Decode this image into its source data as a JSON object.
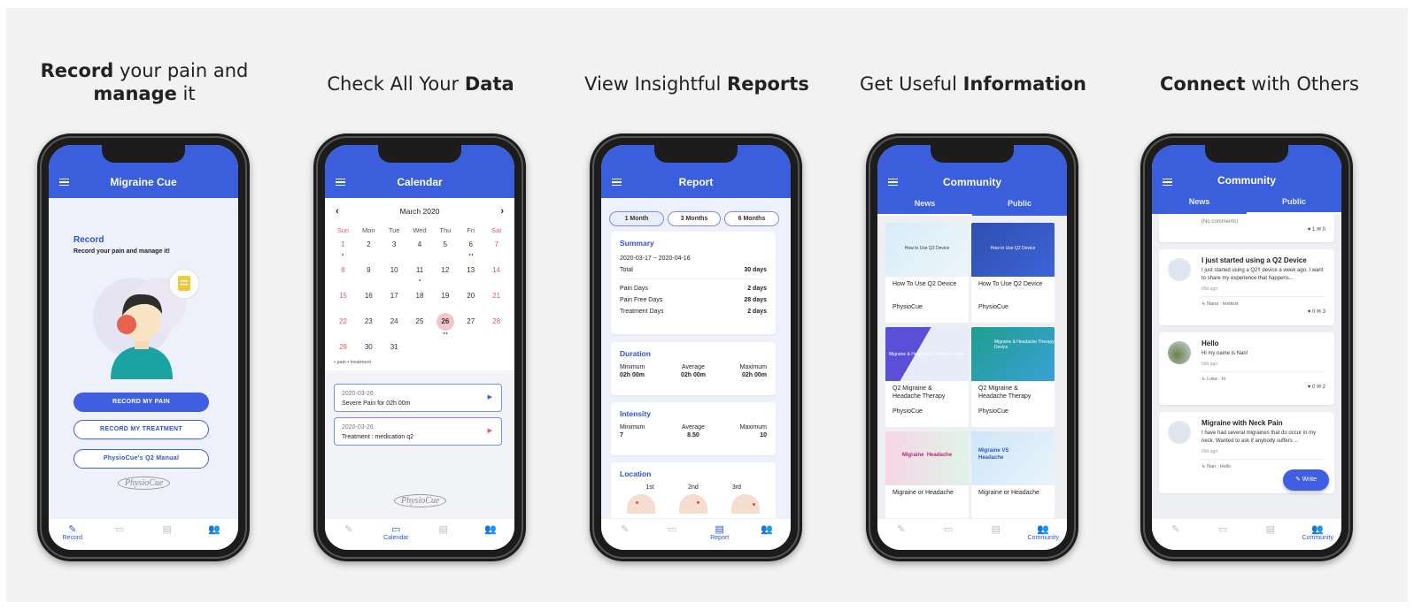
{
  "panels": {
    "record": {
      "headline_pre": "Record",
      "headline_mid": " your pain and",
      "headline_b2": "manage",
      "headline_post": " it",
      "app_title": "Migraine Cue",
      "heading": "Record",
      "subheading": "Record your pain and manage it!",
      "btn_pain": "RECORD MY PAIN",
      "btn_treatment": "RECORD MY TREATMENT",
      "btn_manual": "PhysioCue's Q2 Manual",
      "logo": "PhysioCue",
      "nav_label": "Record"
    },
    "calendar": {
      "headline_pre": "Check All Your ",
      "headline_b": "Data",
      "app_title": "Calendar",
      "month": "March 2020",
      "days": [
        "Sun",
        "Mon",
        "Tue",
        "Wed",
        "Thu",
        "Fri",
        "Sat"
      ],
      "legend": "• pain  • treatment",
      "entries": [
        {
          "date": "2020-03-26",
          "text": "Severe Pain for 02h 00m"
        },
        {
          "date": "2020-03-26",
          "text": "Treatment : medication q2"
        }
      ],
      "logo": "PhysioCue",
      "nav_label": "Calendar"
    },
    "report": {
      "headline_pre": "View Insightful ",
      "headline_b": "Reports",
      "app_title": "Report",
      "pills": [
        "1 Month",
        "3 Months",
        "6 Months"
      ],
      "summary_title": "Summary",
      "range": "2020-03-17 ~ 2020-04-16",
      "total_label": "Total",
      "total_value": "30 days",
      "pain_days_label": "Pain Days",
      "pain_days_value": "2 days",
      "pain_free_label": "Pain Free Days",
      "pain_free_value": "28 days",
      "treat_label": "Treatment Days",
      "treat_value": "2 days",
      "duration_title": "Duration",
      "dur_min_label": "Minimum",
      "dur_min": "02h 00m",
      "dur_avg_label": "Average",
      "dur_avg": "02h 00m",
      "dur_max_label": "Maximum",
      "dur_max": "02h 00m",
      "intensity_title": "Intensity",
      "int_min_label": "Minimum",
      "int_min": "7",
      "int_avg_label": "Average",
      "int_avg": "8.50",
      "int_max_label": "Maximum",
      "int_max": "10",
      "location_title": "Location",
      "loc_1": "1st",
      "loc_2": "2nd",
      "loc_3": "3rd",
      "nav_label": "Report"
    },
    "info": {
      "headline_pre": "Get Useful ",
      "headline_b": "Information",
      "app_title": "Community",
      "tab_news": "News",
      "tab_public": "Public",
      "tiles": [
        {
          "title": "How To Use Q2 Device",
          "source": "PhysioCue"
        },
        {
          "title": "How To Use Q2 Device",
          "source": "PhysioCue"
        },
        {
          "title": "Q2 Migraine & Headache Therapy",
          "source": "PhysioCue"
        },
        {
          "title": "Q2 Migraine & Headache Therapy",
          "source": "PhysioCue"
        },
        {
          "title": "Migraine or Headache",
          "source": ""
        },
        {
          "title": "Migraine or Headache",
          "source": ""
        }
      ],
      "tile_img_text": [
        "How to Use Q2 Device",
        "How to Use Q2 Device",
        "Migraine & Headache Therapy Device",
        "Migraine & Headache Therapy Device",
        "Migraine  Headache",
        "Migraine VS Headache"
      ],
      "nav_label": "Community"
    },
    "connect": {
      "headline_b": "Connect",
      "headline_post": " with Others",
      "app_title": "Community",
      "tab_news": "News",
      "tab_public": "Public",
      "first_note": "(No comments)",
      "first_stats": "♥ 1   ✉ 0",
      "posts": [
        {
          "title": "I just started using a Q2 Device",
          "body": "I just started using a Q2!! device a week ago. I want to share my experience that happens...",
          "ago": "69d ago",
          "reply": "↳  Nana : testtest",
          "stats": "♥ 0   ✉ 3"
        },
        {
          "title": "Hello",
          "body": "Hi my name is Nan!",
          "ago": "69d ago",
          "reply": "↳  Luke : hi",
          "stats": "♥ 0   ✉ 2"
        },
        {
          "title": "Migraine with Neck Pain",
          "body": "I have had several migraines that do occur in my neck. Wanted to ask if anybody suffers ...",
          "ago": "69d ago",
          "reply": "↳  Nan : Hello",
          "stats": ""
        }
      ],
      "write": "Write",
      "nav_label": "Community"
    }
  },
  "colors": {
    "primary": "#3b5fdc",
    "panel_bg": "#f2f2f2",
    "weekend_red": "#e05a6a"
  }
}
